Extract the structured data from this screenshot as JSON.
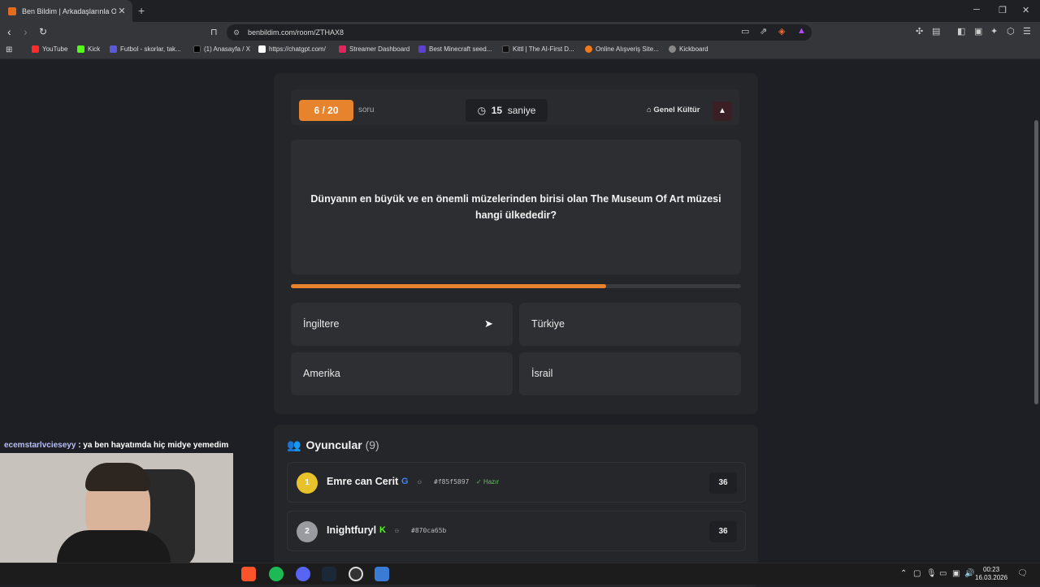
{
  "browser": {
    "tab_title": "Ben Bildim | Arkadaşlarınla Onlin",
    "url": "benbildim.com/room/ZTHAX8",
    "bookmarks": [
      {
        "label": "YouTube",
        "color": "#ff2b2b"
      },
      {
        "label": "Kick",
        "color": "#53fc18"
      },
      {
        "label": "Futbol - skorlar, tak...",
        "color": "#5a5ad8"
      },
      {
        "label": "(1) Anasayfa / X",
        "color": "#000000"
      },
      {
        "label": "https://chatgpt.com/",
        "color": "#ffffff"
      },
      {
        "label": "Streamer Dashboard",
        "color": "#e0245e"
      },
      {
        "label": "Best Minecraft seed...",
        "color": "#5d3fd3"
      },
      {
        "label": "Kittl | The AI-First D...",
        "color": "#111111"
      },
      {
        "label": "Online Alışveriş Site...",
        "color": "#f27a1a"
      },
      {
        "label": "Kickboard",
        "color": "#888888"
      }
    ]
  },
  "quiz": {
    "progress_label": "6 / 20",
    "progress_unit": "soru",
    "timer_value": "15",
    "timer_unit": "saniye",
    "category": "Genel Kültür",
    "question": "Dünyanın en büyük ve en önemli müzelerinden birisi olan The Museum Of Art müzesi hangi ülkededir?",
    "time_fraction": 0.7,
    "options": [
      "İngiltere",
      "Türkiye",
      "Amerika",
      "İsrail"
    ]
  },
  "players": {
    "title": "Oyuncular",
    "count": "(9)",
    "list": [
      {
        "rank": "1",
        "name": "Emre can Cerit",
        "id": "#f85f5897",
        "status": "Hazır",
        "score": "36",
        "rank_color": "#e8c22a"
      },
      {
        "rank": "2",
        "name": "Inightfuryl",
        "id": "#870ca65b",
        "score": "36",
        "rank_color": "#9a9ba0"
      }
    ]
  },
  "chat": {
    "user": "ecemstarlvcieseyy",
    "message": " : ya ben hayatımda hiç midye yemedim"
  },
  "taskbar": {
    "time": "00:23",
    "date": "16.03.2026"
  }
}
